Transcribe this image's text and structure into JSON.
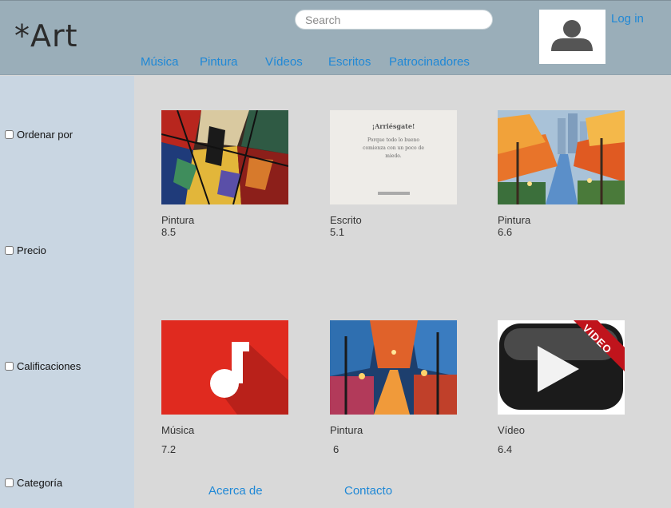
{
  "header": {
    "logo": "*Art",
    "search_placeholder": "Search",
    "login": "Log in"
  },
  "nav": {
    "musica": "Música",
    "pintura": "Pintura",
    "videos": "Vídeos",
    "escritos": "Escritos",
    "patrocinadores": "Patrocinadores"
  },
  "sidebar": {
    "filters": [
      "Ordenar por",
      "Precio",
      "Calificaciones",
      "Categoría"
    ]
  },
  "cards": [
    {
      "label": "Pintura",
      "score": "8.5",
      "icon": "cubist-painting"
    },
    {
      "label": "Escrito",
      "score": "5.1",
      "icon": "quote-text",
      "quote_title": "¡Arriésgate!",
      "quote_body": "Porque todo lo bueno comienza con un poco de miedo."
    },
    {
      "label": "Pintura",
      "score": "6.6",
      "icon": "autumn-city-painting"
    },
    {
      "label": "Música",
      "score": "7.2",
      "icon": "music-note"
    },
    {
      "label": "Pintura",
      "score": "6",
      "icon": "rainy-park-painting"
    },
    {
      "label": "Vídeo",
      "score": "6.4",
      "icon": "video-play",
      "video_ribbon": "VIDEO"
    }
  ],
  "footer": {
    "about": "Acerca de",
    "contact": "Contacto"
  },
  "colors": {
    "header": "#9aaeb9",
    "sidebar": "#c9d6e2",
    "content": "#d9d9d9",
    "link": "#1f88d6"
  }
}
